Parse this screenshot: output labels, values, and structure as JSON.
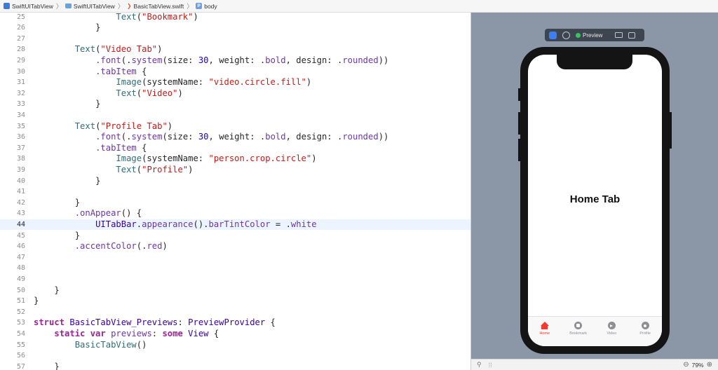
{
  "breadcrumb": {
    "project": "SwiftUITabView",
    "folder": "SwiftUITabView",
    "file": "BasicTabView.swift",
    "symbol": "body",
    "symbol_glyph": "P",
    "file_glyph": "❯",
    "separator": "〉"
  },
  "editor": {
    "current_line": 44,
    "lines": [
      {
        "n": "25",
        "indent": "                ",
        "tokens": [
          [
            "fn",
            "Text"
          ],
          [
            "plain",
            "("
          ],
          [
            "str",
            "\"Bookmark\""
          ],
          [
            "plain",
            ")"
          ]
        ]
      },
      {
        "n": "26",
        "indent": "            ",
        "tokens": [
          [
            "plain",
            "}"
          ]
        ]
      },
      {
        "n": "27",
        "indent": "",
        "tokens": []
      },
      {
        "n": "28",
        "indent": "        ",
        "tokens": [
          [
            "fn",
            "Text"
          ],
          [
            "plain",
            "("
          ],
          [
            "str",
            "\"Video Tab\""
          ],
          [
            "plain",
            ")"
          ]
        ]
      },
      {
        "n": "29",
        "indent": "            ",
        "tokens": [
          [
            "mem",
            ".font"
          ],
          [
            "plain",
            "(."
          ],
          [
            "mem",
            "system"
          ],
          [
            "plain",
            "(size: "
          ],
          [
            "num",
            "30"
          ],
          [
            "plain",
            ", weight: ."
          ],
          [
            "mem",
            "bold"
          ],
          [
            "plain",
            ", design: ."
          ],
          [
            "mem",
            "rounded"
          ],
          [
            "plain",
            "))"
          ]
        ]
      },
      {
        "n": "30",
        "indent": "            ",
        "tokens": [
          [
            "mem",
            ".tabItem"
          ],
          [
            "plain",
            " {"
          ]
        ]
      },
      {
        "n": "31",
        "indent": "                ",
        "tokens": [
          [
            "fn",
            "Image"
          ],
          [
            "plain",
            "(systemName: "
          ],
          [
            "str",
            "\"video.circle.fill\""
          ],
          [
            "plain",
            ")"
          ]
        ]
      },
      {
        "n": "32",
        "indent": "                ",
        "tokens": [
          [
            "fn",
            "Text"
          ],
          [
            "plain",
            "("
          ],
          [
            "str",
            "\"Video\""
          ],
          [
            "plain",
            ")"
          ]
        ]
      },
      {
        "n": "33",
        "indent": "            ",
        "tokens": [
          [
            "plain",
            "}"
          ]
        ]
      },
      {
        "n": "34",
        "indent": "",
        "tokens": []
      },
      {
        "n": "35",
        "indent": "        ",
        "tokens": [
          [
            "fn",
            "Text"
          ],
          [
            "plain",
            "("
          ],
          [
            "str",
            "\"Profile Tab\""
          ],
          [
            "plain",
            ")"
          ]
        ]
      },
      {
        "n": "36",
        "indent": "            ",
        "tokens": [
          [
            "mem",
            ".font"
          ],
          [
            "plain",
            "(."
          ],
          [
            "mem",
            "system"
          ],
          [
            "plain",
            "(size: "
          ],
          [
            "num",
            "30"
          ],
          [
            "plain",
            ", weight: ."
          ],
          [
            "mem",
            "bold"
          ],
          [
            "plain",
            ", design: ."
          ],
          [
            "mem",
            "rounded"
          ],
          [
            "plain",
            "))"
          ]
        ]
      },
      {
        "n": "37",
        "indent": "            ",
        "tokens": [
          [
            "mem",
            ".tabItem"
          ],
          [
            "plain",
            " {"
          ]
        ]
      },
      {
        "n": "38",
        "indent": "                ",
        "tokens": [
          [
            "fn",
            "Image"
          ],
          [
            "plain",
            "(systemName: "
          ],
          [
            "str",
            "\"person.crop.circle\""
          ],
          [
            "plain",
            ")"
          ]
        ]
      },
      {
        "n": "39",
        "indent": "                ",
        "tokens": [
          [
            "fn",
            "Text"
          ],
          [
            "plain",
            "("
          ],
          [
            "str",
            "\"Profile\""
          ],
          [
            "plain",
            ")"
          ]
        ]
      },
      {
        "n": "40",
        "indent": "            ",
        "tokens": [
          [
            "plain",
            "}"
          ]
        ]
      },
      {
        "n": "41",
        "indent": "",
        "tokens": []
      },
      {
        "n": "42",
        "indent": "        ",
        "tokens": [
          [
            "plain",
            "}"
          ]
        ]
      },
      {
        "n": "43",
        "indent": "        ",
        "tokens": [
          [
            "mem",
            ".onAppear"
          ],
          [
            "plain",
            "() {"
          ]
        ]
      },
      {
        "n": "44",
        "indent": "            ",
        "tokens": [
          [
            "typ",
            "UITabBar"
          ],
          [
            "plain",
            "."
          ],
          [
            "mem",
            "appearance"
          ],
          [
            "plain",
            "()."
          ],
          [
            "mem",
            "barTintColor"
          ],
          [
            "plain",
            " = ."
          ],
          [
            "mem",
            "white"
          ]
        ]
      },
      {
        "n": "45",
        "indent": "        ",
        "tokens": [
          [
            "plain",
            "}"
          ]
        ]
      },
      {
        "n": "46",
        "indent": "        ",
        "tokens": [
          [
            "mem",
            ".accentColor"
          ],
          [
            "plain",
            "(."
          ],
          [
            "mem",
            "red"
          ],
          [
            "plain",
            ")"
          ]
        ]
      },
      {
        "n": "47",
        "indent": "",
        "tokens": []
      },
      {
        "n": "48",
        "indent": "",
        "tokens": []
      },
      {
        "n": "49",
        "indent": "",
        "tokens": []
      },
      {
        "n": "50",
        "indent": "    ",
        "tokens": [
          [
            "plain",
            "}"
          ]
        ]
      },
      {
        "n": "51",
        "indent": "",
        "tokens": [
          [
            "plain",
            "}"
          ]
        ]
      },
      {
        "n": "52",
        "indent": "",
        "tokens": []
      },
      {
        "n": "53",
        "indent": "",
        "tokens": [
          [
            "kw",
            "struct"
          ],
          [
            "plain",
            " "
          ],
          [
            "typ",
            "BasicTabView_Previews"
          ],
          [
            "plain",
            ": "
          ],
          [
            "typ",
            "PreviewProvider"
          ],
          [
            "plain",
            " {"
          ]
        ]
      },
      {
        "n": "54",
        "indent": "    ",
        "tokens": [
          [
            "kw",
            "static var"
          ],
          [
            "plain",
            " "
          ],
          [
            "mem",
            "previews"
          ],
          [
            "plain",
            ": "
          ],
          [
            "kw",
            "some"
          ],
          [
            "plain",
            " "
          ],
          [
            "typ",
            "View"
          ],
          [
            "plain",
            " {"
          ]
        ]
      },
      {
        "n": "55",
        "indent": "        ",
        "tokens": [
          [
            "fn",
            "BasicTabView"
          ],
          [
            "plain",
            "()"
          ]
        ]
      },
      {
        "n": "56",
        "indent": "",
        "tokens": []
      },
      {
        "n": "57",
        "indent": "    ",
        "tokens": [
          [
            "plain",
            "}"
          ]
        ]
      }
    ]
  },
  "preview": {
    "toolbar": {
      "live_icon": "live-preview-icon",
      "inspect_icon": "selectable-mode-icon",
      "status_label": "Preview",
      "device_icon": "device-settings-icon",
      "duplicate_icon": "duplicate-preview-icon"
    },
    "screen_title": "Home Tab",
    "tabs": [
      {
        "label": "Home",
        "icon": "house-icon",
        "active": true
      },
      {
        "label": "Bookmark",
        "icon": "bookmark-circle-icon",
        "active": false
      },
      {
        "label": "Video",
        "icon": "video-circle-icon",
        "active": false
      },
      {
        "label": "Profile",
        "icon": "person-crop-circle-icon",
        "active": false
      }
    ],
    "accent_color": "#f23a2f",
    "zoom": "79%",
    "zoom_out_glyph": "⊖",
    "zoom_in_glyph": "⊕",
    "pin_glyph": "⚲",
    "grid_glyph": "⁞⁞"
  }
}
